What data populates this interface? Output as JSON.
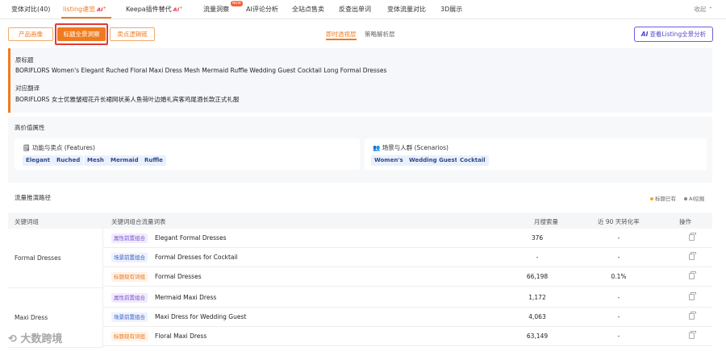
{
  "tabs": [
    {
      "label": "变体对比(40)"
    },
    {
      "label": "listing速览",
      "badge": "AI",
      "active": true
    },
    {
      "label": "Keepa插件替代",
      "badge": "AI"
    },
    {
      "label": "流量洞察",
      "new": "NEW"
    },
    {
      "label": "AI评论分析"
    },
    {
      "label": "全站点售卖"
    },
    {
      "label": "反查出单词"
    },
    {
      "label": "变体流量对比"
    },
    {
      "label": "3D展示"
    }
  ],
  "collapse_label": "收起 ⌃",
  "sub_buttons": [
    "产品画像",
    "标题全景洞察",
    "卖点逻辑链"
  ],
  "modes": [
    "即时透视层",
    "策略解析层"
  ],
  "listing_button": {
    "ai": "AI",
    "label": "查看Listing全景分析"
  },
  "title_panel": {
    "original_label": "原标题",
    "original_text": "BORIFLORS Women's Elegant Ruched Floral Maxi Dress Mesh Mermaid Ruffle Wedding Guest Cocktail Long Formal Dresses",
    "translation_label": "对应翻译",
    "translation_text": "BORIFLORS 女士优雅皱褶花卉长裙网状美人鱼荷叶边婚礼宾客鸡尾酒长款正式礼服"
  },
  "attributes": {
    "title": "高价值属性",
    "features_title": "🗒 功能与卖点 (Features)",
    "features": [
      "Elegant",
      "Ruched",
      "Mesh",
      "Mermaid",
      "Ruffle"
    ],
    "scenarios_title": "👥 场景与人群 (Scenarios)",
    "scenarios": [
      "Women's",
      "Wedding Guest",
      "Cocktail"
    ]
  },
  "traffic": {
    "title": "流量推演路径",
    "legend": [
      {
        "label": "标题已有",
        "color": "#f5a623"
      },
      {
        "label": "AI挖掘",
        "color": "#888888"
      }
    ],
    "headers": [
      "关键词组",
      "关键词组合流量词表",
      "月搜索量",
      "近 90 天转化率",
      "操作"
    ],
    "groups": [
      {
        "name": "Formal Dresses",
        "rows": [
          {
            "tag": "属性前置组合",
            "tag_type": "attr",
            "keyword": "Elegant Formal Dresses",
            "volume": "376",
            "conversion": "-"
          },
          {
            "tag": "场景前置组合",
            "tag_type": "scene",
            "keyword": "Formal Dresses for Cocktail",
            "volume": "-",
            "conversion": "-"
          },
          {
            "tag": "标题现有词组",
            "tag_type": "own",
            "keyword": "Formal Dresses",
            "volume": "66,198",
            "conversion": "0.1%"
          }
        ]
      },
      {
        "name": "Maxi Dress",
        "rows": [
          {
            "tag": "属性前置组合",
            "tag_type": "attr",
            "keyword": "Mermaid Maxi Dress",
            "volume": "1,172",
            "conversion": "-"
          },
          {
            "tag": "场景前置组合",
            "tag_type": "scene",
            "keyword": "Maxi Dress for Wedding Guest",
            "volume": "4,063",
            "conversion": "-"
          },
          {
            "tag": "标题现有词组",
            "tag_type": "own",
            "keyword": "Floral Maxi Dress",
            "volume": "63,149",
            "conversion": "-"
          }
        ]
      }
    ]
  },
  "watermark": "大数跨境",
  "colors": {
    "accent": "#f07b1e",
    "highlight_box": "#e53935",
    "ai_purple": "#5548c9"
  }
}
